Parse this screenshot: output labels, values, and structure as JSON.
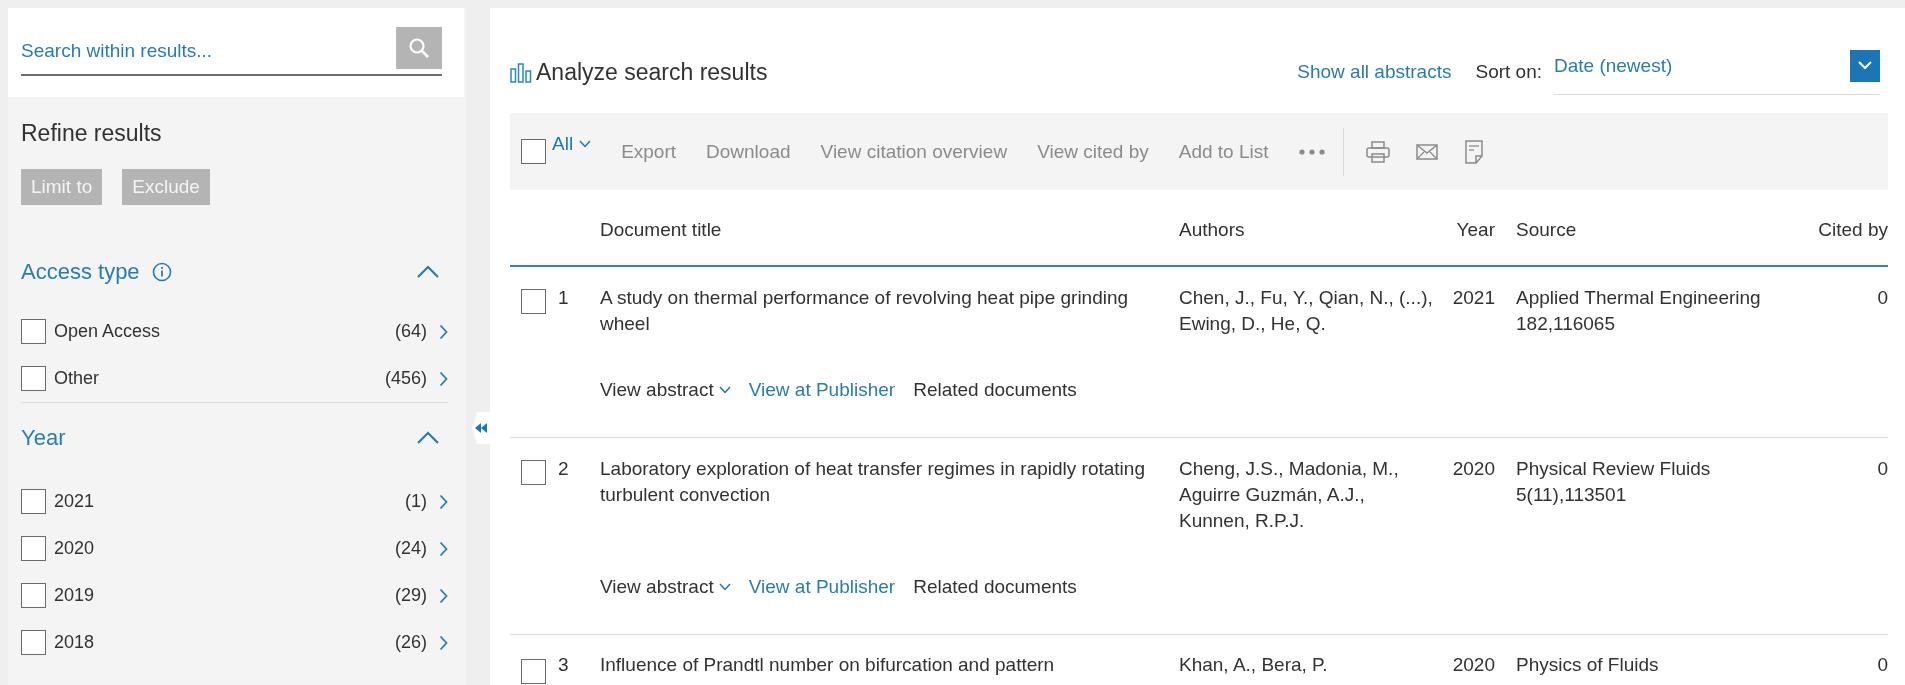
{
  "search": {
    "placeholder": "Search within results..."
  },
  "refine": {
    "title": "Refine results",
    "buttons": [
      "Limit to",
      "Exclude"
    ]
  },
  "facets": [
    {
      "title": "Access type",
      "info": true,
      "expanded": true,
      "items": [
        {
          "label": "Open Access",
          "count": "(64)",
          "checked": false
        },
        {
          "label": "Other",
          "count": "(456)",
          "checked": false
        }
      ]
    },
    {
      "title": "Year",
      "expanded": true,
      "items": [
        {
          "label": "2021",
          "count": "(1)",
          "checked": false
        },
        {
          "label": "2020",
          "count": "(24)",
          "checked": false
        },
        {
          "label": "2019",
          "count": "(29)",
          "checked": false
        },
        {
          "label": "2018",
          "count": "(26)",
          "checked": false
        }
      ]
    }
  ],
  "analyze": {
    "label": "Analyze search results"
  },
  "show_all_abstracts": "Show all abstracts",
  "sort": {
    "label": "Sort on:",
    "value": "Date (newest)"
  },
  "toolbar": {
    "select_all": {
      "label": "All",
      "checked": false
    },
    "actions": [
      {
        "label": "Export",
        "disabled": true
      },
      {
        "label": "Download",
        "disabled": true
      },
      {
        "label": "View citation overview",
        "disabled": true
      },
      {
        "label": "View cited by",
        "disabled": true
      },
      {
        "label": "Add to List",
        "disabled": true
      }
    ]
  },
  "table": {
    "columns": [
      "Document title",
      "Authors",
      "Year",
      "Source",
      "Cited by"
    ],
    "rows": [
      {
        "number": "1",
        "checked": false,
        "title": "A study on thermal performance of revolving heat pipe grinding wheel",
        "authors": "Chen, J., Fu, Y., Qian, N., (...), Ewing, D., He, Q.",
        "year": "2021",
        "source": "Applied Thermal Engineering",
        "source_detail": "182,116065",
        "cited_by": "0",
        "links": [
          {
            "label": "View abstract",
            "kind": "toggle"
          },
          {
            "label": "View at Publisher",
            "kind": "external"
          },
          {
            "label": "Related documents",
            "kind": "plain"
          }
        ]
      },
      {
        "number": "2",
        "checked": false,
        "title": "Laboratory exploration of heat transfer regimes in rapidly rotating turbulent convection",
        "authors": "Cheng, J.S., Madonia, M., Aguirre Guzmán, A.J., Kunnen, R.P.J.",
        "year": "2020",
        "source": "Physical Review Fluids",
        "source_detail": "5(11),113501",
        "cited_by": "0",
        "links": [
          {
            "label": "View abstract",
            "kind": "toggle"
          },
          {
            "label": "View at Publisher",
            "kind": "external"
          },
          {
            "label": "Related documents",
            "kind": "plain"
          }
        ]
      },
      {
        "number": "3",
        "checked": false,
        "title": "Influence of Prandtl number on bifurcation and pattern",
        "authors": "Khan, A., Bera, P.",
        "year": "2020",
        "source": "Physics of Fluids",
        "cited_by": "0"
      }
    ]
  }
}
